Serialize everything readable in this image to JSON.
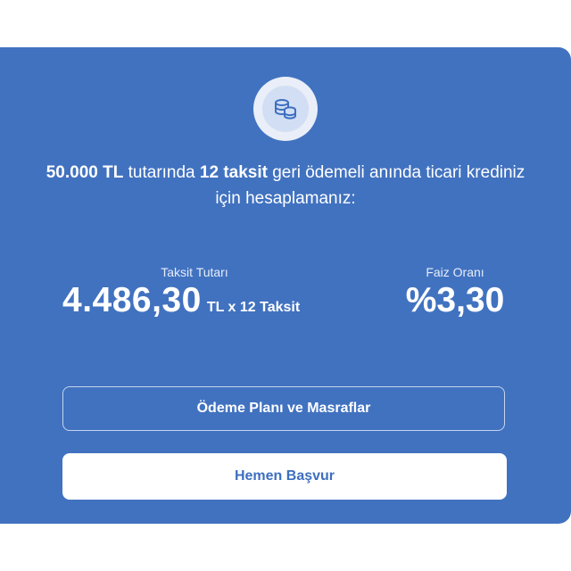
{
  "header": {
    "icon": "coins-icon",
    "intro": {
      "amount": "50.000 TL",
      "text1": " tutarında ",
      "installments": "12 taksit",
      "text2": " geri ödemeli anında ticari krediniz için hesaplamanız:"
    }
  },
  "installment": {
    "label": "Taksit Tutarı",
    "value": "4.486,30",
    "suffix": "TL x 12 Taksit"
  },
  "interest": {
    "label": "Faiz Oranı",
    "value": "%3,30"
  },
  "buttons": {
    "plan_label": "Ödeme Planı ve Masraflar",
    "apply_label": "Hemen Başvur"
  },
  "colors": {
    "card": "#4172c0",
    "button_text": "#3d6fbf",
    "icon_circle": "#e9eef8"
  }
}
